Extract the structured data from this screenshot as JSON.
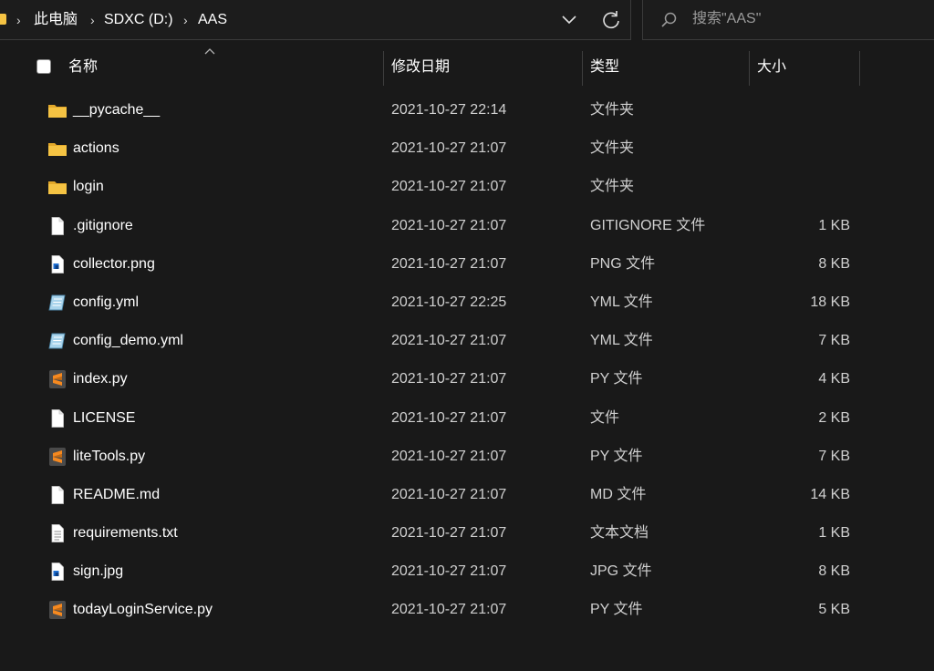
{
  "address": {
    "crumbs": [
      "此电脑",
      "SDXC (D:)",
      "AAS"
    ],
    "separator": "›"
  },
  "search": {
    "placeholder": "搜索\"AAS\""
  },
  "columns": {
    "name": "名称",
    "date": "修改日期",
    "type": "类型",
    "size": "大小"
  },
  "files": [
    {
      "name": "__pycache__",
      "date": "2021-10-27 22:14",
      "type": "文件夹",
      "size": "",
      "icon": "folder-icon"
    },
    {
      "name": "actions",
      "date": "2021-10-27 21:07",
      "type": "文件夹",
      "size": "",
      "icon": "folder-icon"
    },
    {
      "name": "login",
      "date": "2021-10-27 21:07",
      "type": "文件夹",
      "size": "",
      "icon": "folder-icon"
    },
    {
      "name": ".gitignore",
      "date": "2021-10-27 21:07",
      "type": "GITIGNORE 文件",
      "size": "1 KB",
      "icon": "file-icon"
    },
    {
      "name": "collector.png",
      "date": "2021-10-27 21:07",
      "type": "PNG 文件",
      "size": "8 KB",
      "icon": "image-file-icon"
    },
    {
      "name": "config.yml",
      "date": "2021-10-27 22:25",
      "type": "YML 文件",
      "size": "18 KB",
      "icon": "yml-file-icon"
    },
    {
      "name": "config_demo.yml",
      "date": "2021-10-27 21:07",
      "type": "YML 文件",
      "size": "7 KB",
      "icon": "yml-file-icon"
    },
    {
      "name": "index.py",
      "date": "2021-10-27 21:07",
      "type": "PY 文件",
      "size": "4 KB",
      "icon": "sublime-file-icon"
    },
    {
      "name": "LICENSE",
      "date": "2021-10-27 21:07",
      "type": "文件",
      "size": "2 KB",
      "icon": "file-icon"
    },
    {
      "name": "liteTools.py",
      "date": "2021-10-27 21:07",
      "type": "PY 文件",
      "size": "7 KB",
      "icon": "sublime-file-icon"
    },
    {
      "name": "README.md",
      "date": "2021-10-27 21:07",
      "type": "MD 文件",
      "size": "14 KB",
      "icon": "file-icon"
    },
    {
      "name": "requirements.txt",
      "date": "2021-10-27 21:07",
      "type": "文本文档",
      "size": "1 KB",
      "icon": "text-file-icon"
    },
    {
      "name": "sign.jpg",
      "date": "2021-10-27 21:07",
      "type": "JPG 文件",
      "size": "8 KB",
      "icon": "image-file-icon"
    },
    {
      "name": "todayLoginService.py",
      "date": "2021-10-27 21:07",
      "type": "PY 文件",
      "size": "5 KB",
      "icon": "sublime-file-icon"
    }
  ],
  "colors": {
    "background": "#191919",
    "folder": "#f5c343",
    "sublime": "#f6891f",
    "text": "#ffffff"
  }
}
